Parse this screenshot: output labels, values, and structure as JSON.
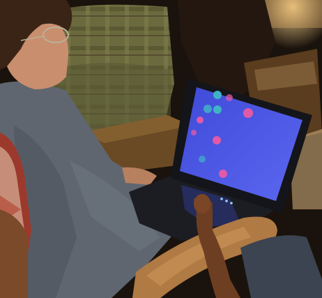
{
  "photo": {
    "description_elements": [
      "person",
      "laptop",
      "armchair",
      "sofa",
      "table"
    ],
    "palette": {
      "background_dark": "#1a120c",
      "sofa_plaid": "#6b6a3e",
      "table_wood": "#6a4a24",
      "shirt_gray": "#5f6670",
      "hair_brown": "#3a2416",
      "skin": "#c98e6e",
      "armrest_wood": "#b07a44",
      "laptop_body": "#1c1d22",
      "screen_blue": "#4a56e6",
      "screen_dot_pink": "#e05aa8",
      "screen_dot_teal": "#3fb3c6",
      "lamp_glow": "#f2d08a",
      "blanket_red": "#9b3a2c"
    },
    "laptop": {
      "screen_message": "",
      "brand_mark": ""
    }
  }
}
